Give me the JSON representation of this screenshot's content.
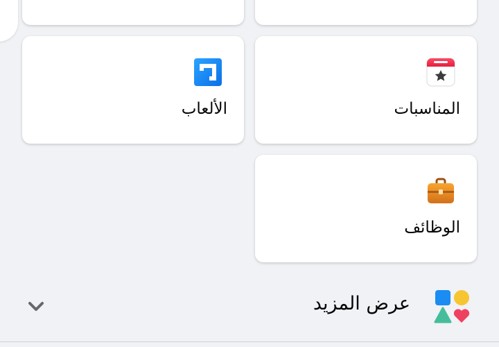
{
  "shortcuts": {
    "events": {
      "label": "المناسبات",
      "icon": "calendar-star-icon"
    },
    "games": {
      "label": "الألعاب",
      "icon": "gaming-icon"
    },
    "jobs": {
      "label": "الوظائف",
      "icon": "briefcase-icon"
    }
  },
  "see_more": {
    "label": "عرض المزيد",
    "icon": "shapes-icon",
    "chevron": "chevron-down-icon"
  },
  "colors": {
    "background": "#f0f2f5",
    "card": "#ffffff",
    "text": "#050505",
    "gaming_blue": "#1877f2",
    "calendar_red": "#f02849",
    "briefcase_orange": "#e8891b"
  }
}
